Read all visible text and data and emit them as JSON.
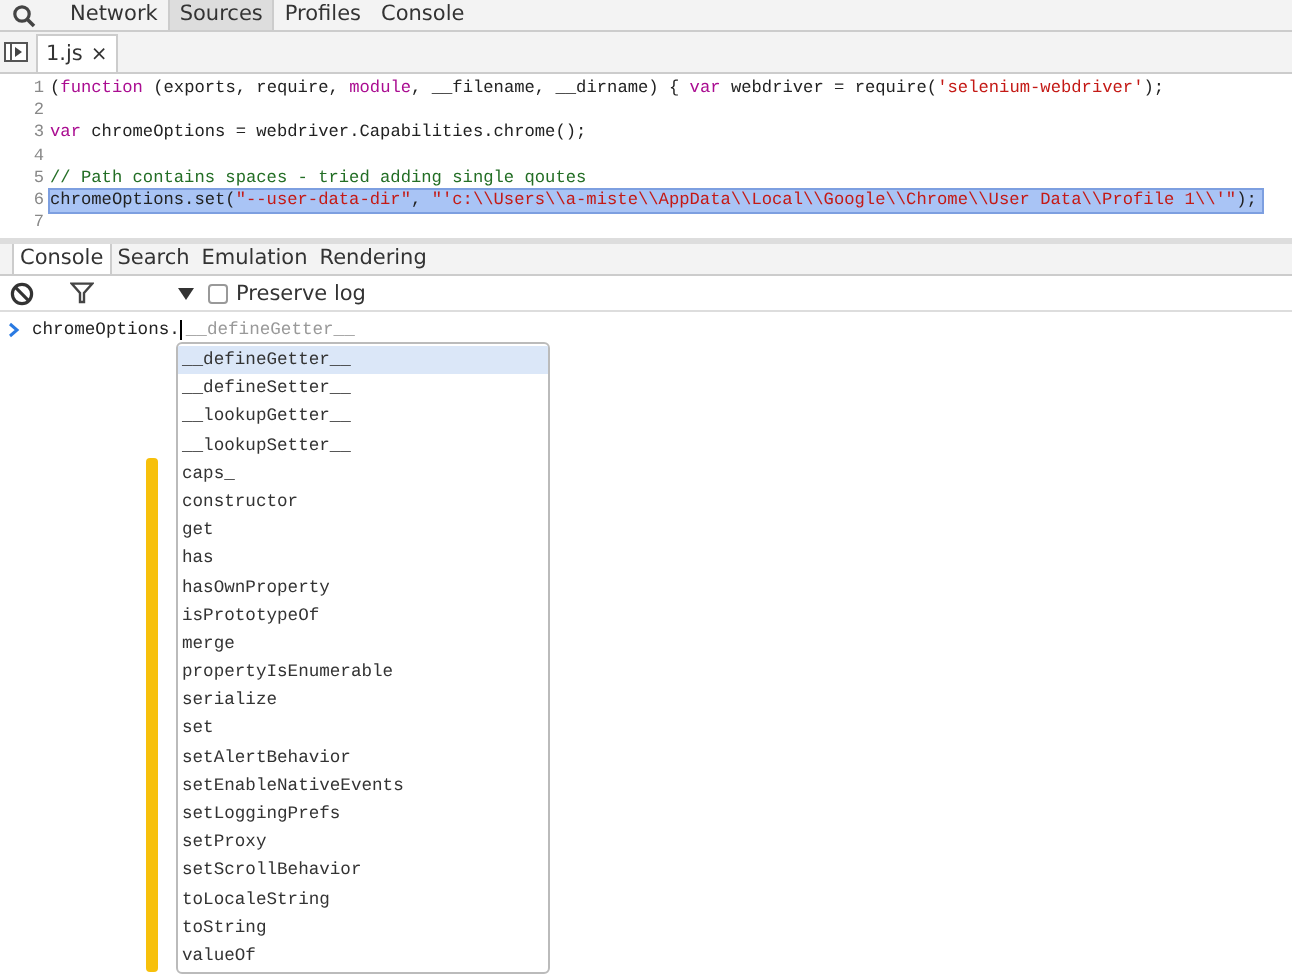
{
  "top_tabs": [
    {
      "label": "Network",
      "selected": false
    },
    {
      "label": "Sources",
      "selected": true
    },
    {
      "label": "Profiles",
      "selected": false
    },
    {
      "label": "Console",
      "selected": false
    }
  ],
  "file_tab": {
    "label": "1.js",
    "close": "×"
  },
  "code_lines": [
    {
      "number": "1",
      "highlighted": false,
      "tokens": [
        {
          "kind": "plain",
          "text": "("
        },
        {
          "kind": "keyword",
          "text": "function"
        },
        {
          "kind": "plain",
          "text": " (exports, require, "
        },
        {
          "kind": "keyword",
          "text": "module"
        },
        {
          "kind": "plain",
          "text": ", __filename, __dirname) { "
        },
        {
          "kind": "keyword",
          "text": "var"
        },
        {
          "kind": "plain",
          "text": " webdriver = require("
        },
        {
          "kind": "string",
          "text": "'selenium-webdriver'"
        },
        {
          "kind": "plain",
          "text": ");"
        }
      ]
    },
    {
      "number": "2",
      "highlighted": false
    },
    {
      "number": "3",
      "highlighted": false,
      "tokens": [
        {
          "kind": "keyword",
          "text": "var"
        },
        {
          "kind": "plain",
          "text": " chromeOptions = webdriver.Capabilities.chrome();"
        }
      ]
    },
    {
      "number": "4",
      "highlighted": false
    },
    {
      "number": "5",
      "highlighted": false,
      "tokens": [
        {
          "kind": "comment",
          "text": "// Path contains spaces - tried adding single qoutes"
        }
      ]
    },
    {
      "number": "6",
      "highlighted": true,
      "tokens": [
        {
          "kind": "plain",
          "text": "chromeOptions.set("
        },
        {
          "kind": "string",
          "text": "\"--user-data-dir\""
        },
        {
          "kind": "plain",
          "text": ", "
        },
        {
          "kind": "string",
          "text": "\"'c:\\\\Users\\\\a-miste\\\\AppData\\\\Local\\\\Google\\\\Chrome\\\\User Data\\\\Profile 1\\\\'\""
        },
        {
          "kind": "plain",
          "text": ");"
        }
      ]
    },
    {
      "number": "7",
      "highlighted": false
    }
  ],
  "drawer_tabs": [
    {
      "label": "Console",
      "selected": true
    },
    {
      "label": "Search",
      "selected": false
    },
    {
      "label": "Emulation",
      "selected": false
    },
    {
      "label": "Rendering",
      "selected": false
    }
  ],
  "preserve_log": {
    "label": "Preserve log",
    "checked": false
  },
  "console_input": {
    "value": "chromeOptions.",
    "suggestion": "__defineGetter__"
  },
  "autocomplete": [
    {
      "label": "__defineGetter__",
      "selected": true
    },
    {
      "label": "__defineSetter__",
      "selected": false
    },
    {
      "label": "__lookupGetter__",
      "selected": false
    },
    {
      "label": "__lookupSetter__",
      "selected": false
    },
    {
      "label": "caps_",
      "selected": false
    },
    {
      "label": "constructor",
      "selected": false
    },
    {
      "label": "get",
      "selected": false
    },
    {
      "label": "has",
      "selected": false
    },
    {
      "label": "hasOwnProperty",
      "selected": false
    },
    {
      "label": "isPrototypeOf",
      "selected": false
    },
    {
      "label": "merge",
      "selected": false
    },
    {
      "label": "propertyIsEnumerable",
      "selected": false
    },
    {
      "label": "serialize",
      "selected": false
    },
    {
      "label": "set",
      "selected": false
    },
    {
      "label": "setAlertBehavior",
      "selected": false
    },
    {
      "label": "setEnableNativeEvents",
      "selected": false
    },
    {
      "label": "setLoggingPrefs",
      "selected": false
    },
    {
      "label": "setProxy",
      "selected": false
    },
    {
      "label": "setScrollBehavior",
      "selected": false
    },
    {
      "label": "toLocaleString",
      "selected": false
    },
    {
      "label": "toString",
      "selected": false
    },
    {
      "label": "valueOf",
      "selected": false
    }
  ]
}
